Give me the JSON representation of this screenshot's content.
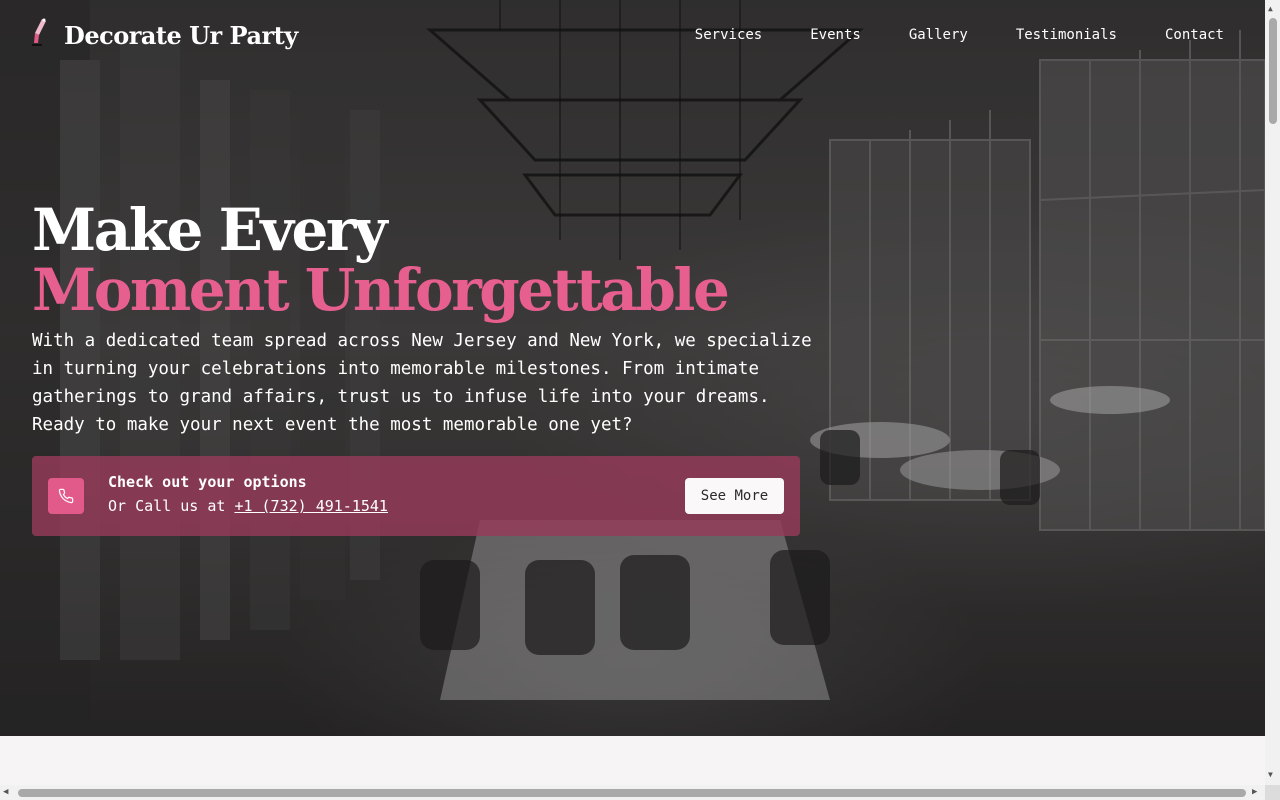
{
  "brand": {
    "name": "Decorate Ur Party",
    "accent": "#e75f8e"
  },
  "nav": {
    "items": [
      "Services",
      "Events",
      "Gallery",
      "Testimonials",
      "Contact"
    ]
  },
  "hero": {
    "headline_line1": "Make Every",
    "headline_line2": "Moment Unforgettable",
    "lead": "With a dedicated team spread across New Jersey and New York, we specialize in turning your celebrations into memorable milestones. From intimate gatherings to grand affairs, trust us to infuse life into your dreams. Ready to make your next event the most memorable one yet?"
  },
  "cta": {
    "icon": "phone-icon",
    "title": "Check out your options",
    "sub_prefix": "Or Call us at",
    "phone": "+1 (732) 491-1541",
    "button_label": "See More",
    "background": "#963a5a",
    "icon_background": "#e25a8a"
  },
  "scrollbars": {
    "up_arrow": "▲",
    "down_arrow": "▼",
    "left_arrow": "◀",
    "right_arrow": "▶"
  }
}
